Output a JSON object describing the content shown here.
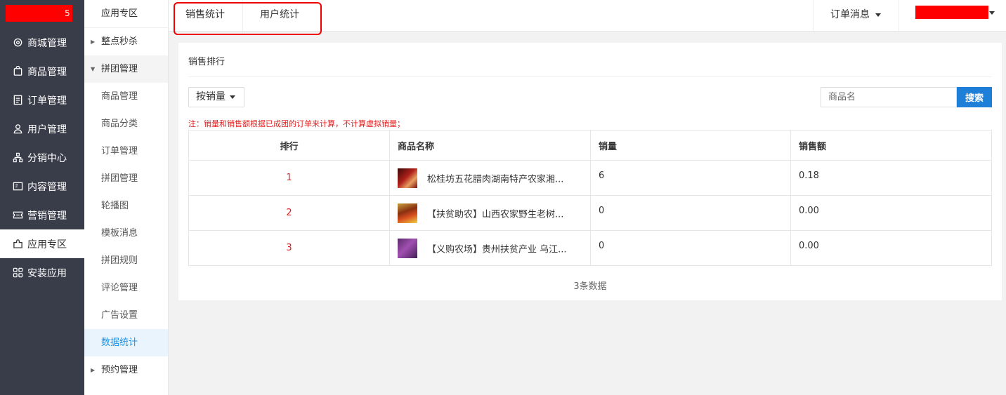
{
  "sidebar": {
    "logo_char": "5",
    "items": [
      {
        "label": "商城管理",
        "icon": "gear-icon"
      },
      {
        "label": "商品管理",
        "icon": "bag-icon"
      },
      {
        "label": "订单管理",
        "icon": "list-icon"
      },
      {
        "label": "用户管理",
        "icon": "user-icon"
      },
      {
        "label": "分销中心",
        "icon": "tree-icon"
      },
      {
        "label": "内容管理",
        "icon": "doc-icon"
      },
      {
        "label": "营销管理",
        "icon": "ticket-icon"
      },
      {
        "label": "应用专区",
        "icon": "puzzle-icon",
        "active": true
      },
      {
        "label": "安装应用",
        "icon": "grid-icon"
      }
    ]
  },
  "submenu": {
    "header": "应用专区",
    "groups": [
      {
        "label": "整点秒杀",
        "open": false
      },
      {
        "label": "拼团管理",
        "open": true
      }
    ],
    "items": [
      "商品管理",
      "商品分类",
      "订单管理",
      "拼团管理",
      "轮播图",
      "模板消息",
      "拼团规则",
      "评论管理",
      "广告设置",
      "数据统计"
    ],
    "active_item": "数据统计",
    "last_group": "预约管理"
  },
  "topbar": {
    "tabs": [
      "销售统计",
      "用户统计"
    ],
    "order_msg": "订单消息"
  },
  "card": {
    "title": "销售排行",
    "sort_select": "按销量",
    "search": {
      "placeholder": "商品名",
      "button": "搜索"
    },
    "note": "注：销量和销售额根据已成团的订单来计算，不计算虚拟销量；",
    "columns": [
      "排行",
      "商品名称",
      "销量",
      "销售额"
    ],
    "rows": [
      {
        "rank": "1",
        "name": "松桂坊五花腊肉湖南特产农家湘...",
        "sales": "6",
        "amount": "0.18"
      },
      {
        "rank": "2",
        "name": "【扶贫助农】山西农家野生老树...",
        "sales": "0",
        "amount": "0.00"
      },
      {
        "rank": "3",
        "name": "【义购农场】贵州扶贫产业 乌江...",
        "sales": "0",
        "amount": "0.00"
      }
    ],
    "total": "3条数据"
  },
  "colors": {
    "sidebar_bg": "#393d49",
    "accent_blue": "#1e7fd8",
    "note_red": "#e02020",
    "highlight_red": "#ee0000"
  }
}
